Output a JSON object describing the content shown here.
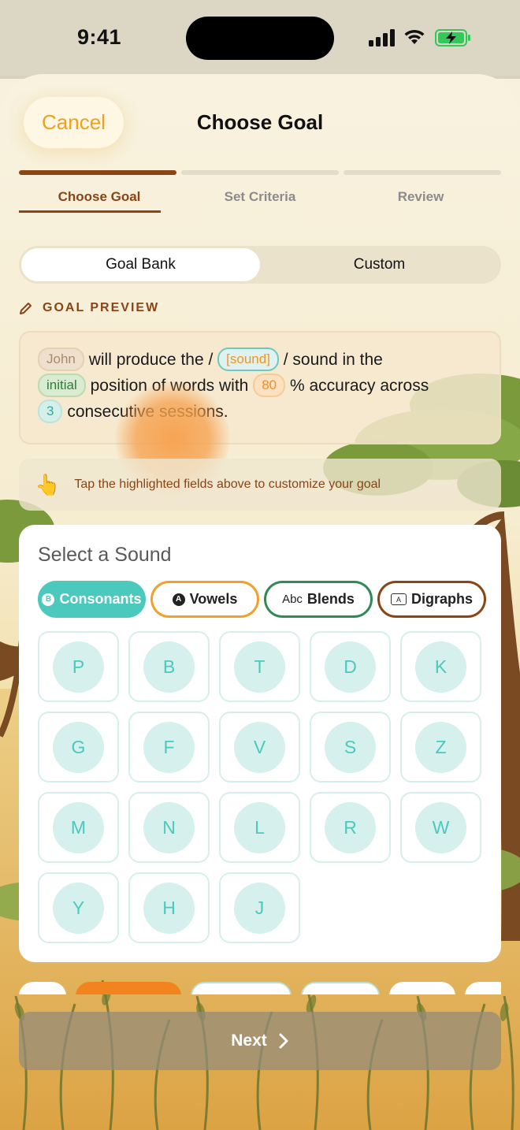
{
  "status_bar": {
    "time": "9:41"
  },
  "header": {
    "cancel_label": "Cancel",
    "title": "Choose Goal"
  },
  "steps": [
    {
      "label": "Choose Goal",
      "active": true
    },
    {
      "label": "Set Criteria",
      "active": false
    },
    {
      "label": "Review",
      "active": false
    }
  ],
  "segmented": {
    "goal_bank": "Goal Bank",
    "custom": "Custom",
    "selected": "Goal Bank"
  },
  "preview": {
    "header": "GOAL PREVIEW",
    "name": "John",
    "text1": "will produce the /",
    "sound": "[sound]",
    "text2": "/ sound in the",
    "position": "initial",
    "text3": "position of words with",
    "accuracy": "80",
    "text4": "% accuracy across",
    "sessions": "3",
    "text5": "consecutive sessions."
  },
  "hint": {
    "emoji": "👆",
    "text": "Tap the highlighted fields above to customize your goal"
  },
  "sound_panel": {
    "title": "Select a Sound",
    "tabs": [
      {
        "label": "Consonants",
        "badge": "B",
        "selected": true
      },
      {
        "label": "Vowels",
        "badge": "A"
      },
      {
        "label": "Blends",
        "prefix": "Abc"
      },
      {
        "label": "Digraphs",
        "icon_text": "A"
      }
    ],
    "sounds": [
      "P",
      "B",
      "T",
      "D",
      "K",
      "G",
      "F",
      "V",
      "S",
      "Z",
      "M",
      "N",
      "L",
      "R",
      "W",
      "Y",
      "H",
      "J"
    ]
  },
  "footer": {
    "next_label": "Next"
  },
  "colors": {
    "brown": "#8a4416",
    "teal": "#4cc9bd",
    "orange": "#f0a01e"
  }
}
